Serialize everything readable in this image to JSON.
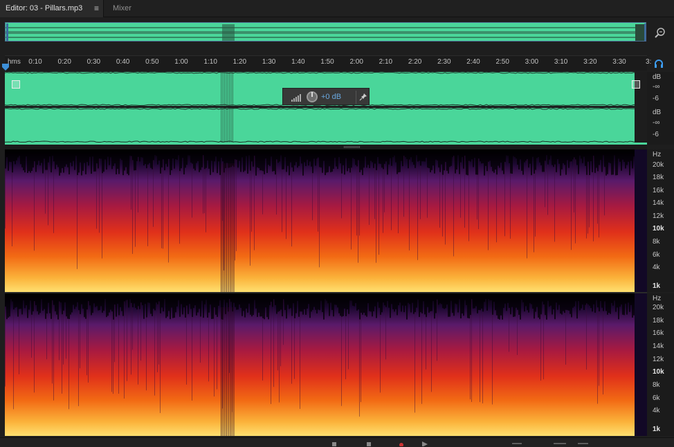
{
  "tabs": {
    "editor": "Editor: 03 - Pillars.mp3",
    "editor_menu": "≡",
    "mixer": "Mixer"
  },
  "ruler": {
    "unit": "hms",
    "ticks": [
      "0:10",
      "0:20",
      "0:30",
      "0:40",
      "0:50",
      "1:00",
      "1:10",
      "1:20",
      "1:30",
      "1:40",
      "1:50",
      "2:00",
      "2:10",
      "2:20",
      "2:30",
      "2:40",
      "2:50",
      "3:00",
      "3:10",
      "3:20",
      "3:30",
      "3:"
    ]
  },
  "hud": {
    "value": "+0 dB"
  },
  "db_scale": {
    "ch1": [
      "dB",
      "-∞",
      "-6"
    ],
    "ch2": [
      "dB",
      "-∞",
      "-6"
    ]
  },
  "hz_scale": [
    "Hz",
    "20k",
    "18k",
    "16k",
    "14k",
    "12k",
    "10k",
    "8k",
    "6k",
    "4k",
    "1k"
  ],
  "colors": {
    "waveform": "#4ad69a",
    "accent": "#6aa8e0",
    "background": "#1e1e1e"
  }
}
